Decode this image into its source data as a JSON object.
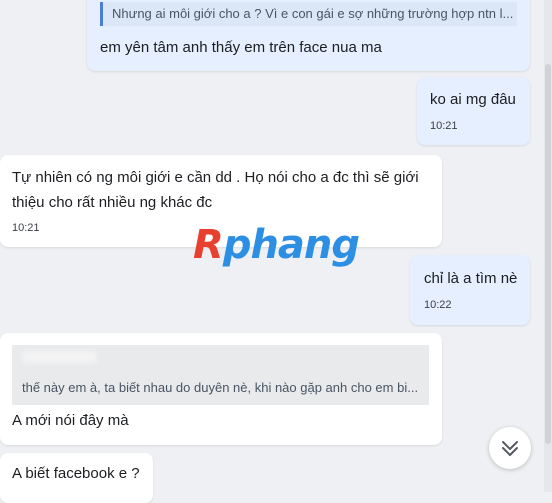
{
  "messages": [
    {
      "id": "m1",
      "direction": "sent",
      "reply_quote": "Nhưng ai môi giới cho a ? Vì e con gái e sợ những trường hợp ntn l...",
      "text": "em yên tâm anh thấy em trên face nua ma"
    },
    {
      "id": "m2",
      "direction": "sent",
      "text": "ko ai mg đâu",
      "time": "10:21"
    },
    {
      "id": "m3",
      "direction": "received",
      "text": "Tự nhiên có ng môi giới e cần dd . Họ nói cho a đc thì sẽ giới thiệu cho rất nhiều ng khác đc",
      "time": "10:21"
    },
    {
      "id": "m4",
      "direction": "sent",
      "text": "chỉ là a tìm nè",
      "time": "10:22"
    },
    {
      "id": "m5",
      "direction": "received",
      "reply_quote": "thế này em à, ta biết nhau do duyên nè, khi nào gặp anh cho em bi...",
      "text": "A mới nói đây mà"
    },
    {
      "id": "m6",
      "direction": "received",
      "text": "A biết facebook e ?"
    }
  ],
  "watermark": {
    "first_letter": "R",
    "rest": "phang"
  },
  "icons": {
    "scroll_down": "chevron-double-down-icon"
  },
  "colors": {
    "sent_bubble": "#e5efff",
    "received_bubble": "#ffffff",
    "quote_bar": "#4a7fd4",
    "background": "#eef0f3"
  }
}
